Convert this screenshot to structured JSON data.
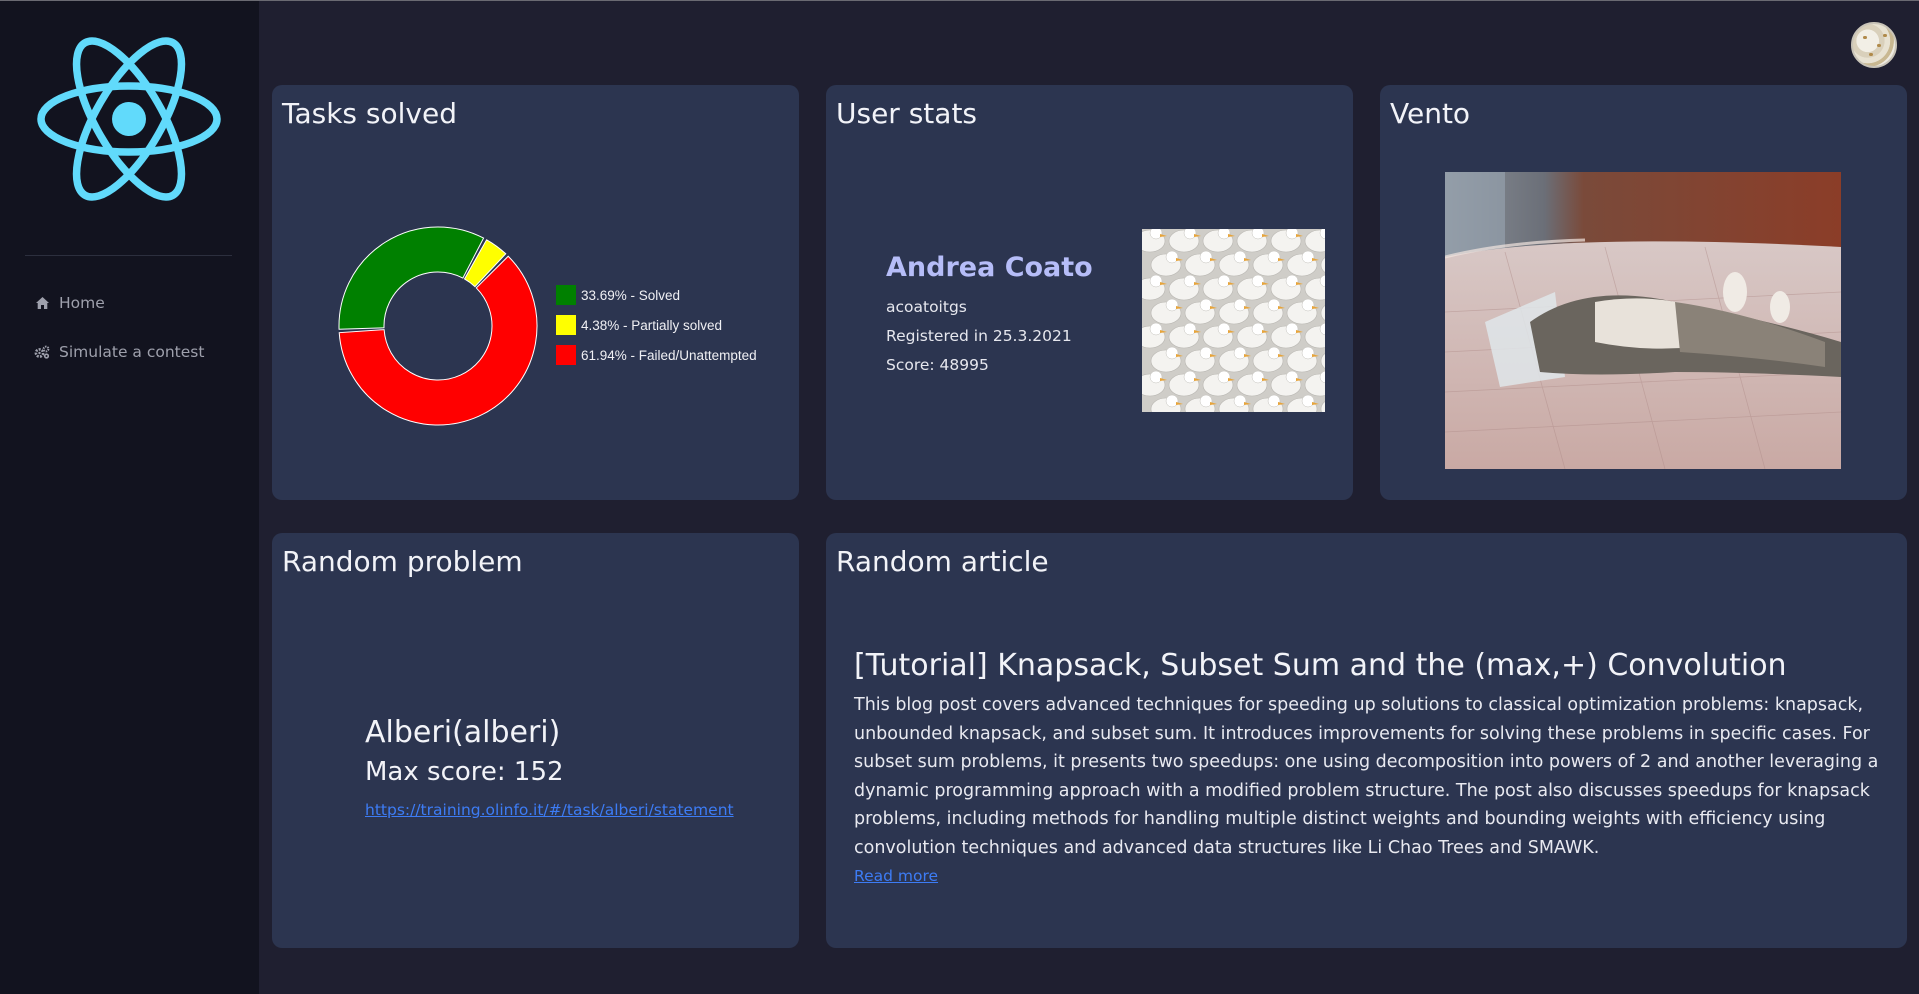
{
  "nav": {
    "items": [
      {
        "icon": "home-icon",
        "label": "Home"
      },
      {
        "icon": "gears-icon",
        "label": "Simulate a contest"
      }
    ]
  },
  "cards": {
    "tasks": {
      "title": "Tasks solved"
    },
    "user": {
      "title": "User stats"
    },
    "vento": {
      "title": "Vento"
    },
    "problem": {
      "title": "Random problem"
    },
    "article": {
      "title": "Random article"
    }
  },
  "chart_data": {
    "type": "pie",
    "donut": true,
    "title": "",
    "series": [
      {
        "name": "33.69% - Solved",
        "value": 33.69,
        "color": "#008000"
      },
      {
        "name": "4.38% - Partially solved",
        "value": 4.38,
        "color": "#ffff00"
      },
      {
        "name": "61.94% - Failed/Unattempted",
        "value": 61.94,
        "color": "#ff0000"
      }
    ],
    "legend": "right"
  },
  "user": {
    "name": "Andrea Coato",
    "username": "acoatoitgs",
    "registered": "Registered in 25.3.2021",
    "score": "Score: 48995"
  },
  "problem": {
    "title": "Alberi(alberi)",
    "max_score": "Max score: 152",
    "link": "https://training.olinfo.it/#/task/alberi/statement"
  },
  "article": {
    "title": "[Tutorial] Knapsack, Subset Sum and the (max,+) Convolution",
    "body": "This blog post covers advanced techniques for speeding up solutions to classical optimization problems: knapsack, unbounded knapsack, and subset sum. It introduces improvements for solving these problems in specific cases. For subset sum problems, it presents two speedups: one using decomposition into powers of 2 and another leveraging a dynamic programming approach with a modified problem structure. The post also discusses speedups for knapsack problems, including methods for handling multiple distinct weights and bounding weights with efficiency using convolution techniques and advanced data structures like Li Chao Trees and SMAWK.",
    "read_more": "Read more"
  },
  "colors": {
    "background": "#1f1f30",
    "sidebar": "#12131f",
    "card": "#2c3550",
    "accent_name": "#b6bdf8",
    "link": "#3d7cf5",
    "logo": "#61dafb"
  }
}
